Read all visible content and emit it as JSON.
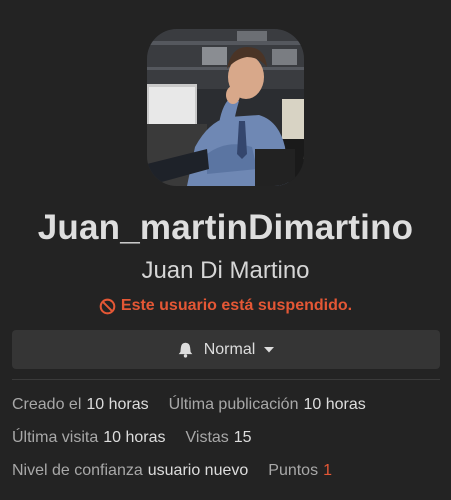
{
  "profile": {
    "username": "Juan_martinDimartino",
    "full_name": "Juan Di Martino",
    "suspended_text": "Este usuario está suspendido."
  },
  "notification": {
    "label": "Normal",
    "icon": "bell-icon"
  },
  "stats": {
    "created_label": "Creado el",
    "created_value": "10 horas",
    "last_post_label": "Última publicación",
    "last_post_value": "10 horas",
    "last_seen_label": "Última visita",
    "last_seen_value": "10 horas",
    "views_label": "Vistas",
    "views_value": "15",
    "trust_label": "Nivel de confianza",
    "trust_value": "usuario nuevo",
    "points_label": "Puntos",
    "points_value": "1"
  },
  "colors": {
    "background": "#232323",
    "alert": "#e45735",
    "button_bg": "#353535"
  }
}
